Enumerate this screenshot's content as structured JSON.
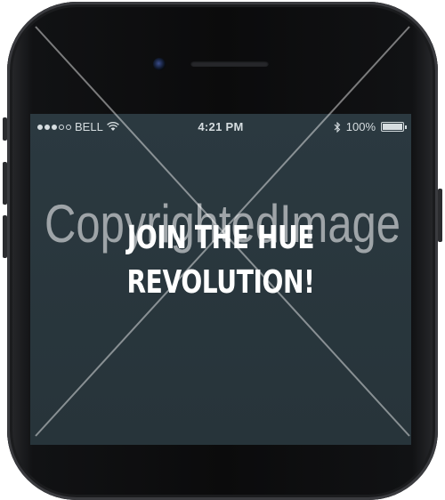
{
  "status_bar": {
    "signal_dots_filled": 3,
    "signal_dots_total": 5,
    "carrier": "BELL",
    "wifi_icon": "wifi-icon",
    "time": "4:21 PM",
    "bluetooth_icon": "bluetooth-icon",
    "battery_text": "100%",
    "battery_level": 1.0
  },
  "screen": {
    "headline_line1": "JOIN THE HUE",
    "headline_line2": "REVOLUTION!"
  },
  "watermark": {
    "text": "CopyrightedImage"
  },
  "colors": {
    "screen_bg": "#2b3940",
    "status_text": "#d6dde0",
    "headline": "#ffffff"
  }
}
